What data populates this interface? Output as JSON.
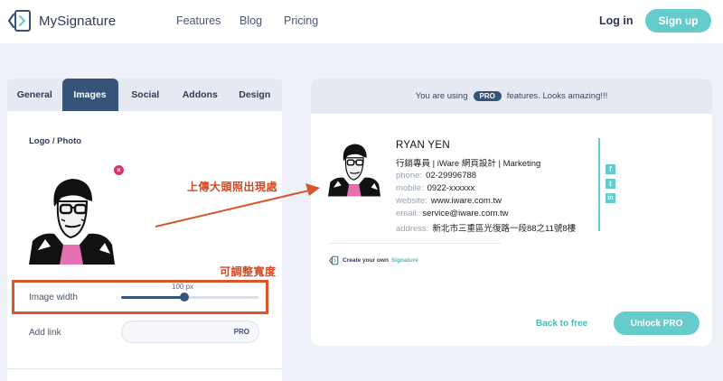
{
  "brand": {
    "name": "MySignature",
    "accent": "#66cbcb",
    "navy": "#36537a"
  },
  "nav": {
    "links": [
      "Features",
      "Blog",
      "Pricing"
    ],
    "login": "Log in",
    "signup": "Sign up"
  },
  "editor": {
    "tabs": [
      "General",
      "Images",
      "Social",
      "Addons",
      "Design"
    ],
    "active_tab": "Images",
    "logo_label": "Logo / Photo",
    "image_width_label": "Image width",
    "image_width_value": "100 px",
    "image_width_fraction": 0.46,
    "add_link_label": "Add link",
    "add_link_badge": "PRO"
  },
  "preview": {
    "banner_left": "You are using",
    "banner_pill": "PRO",
    "banner_right": "features. Looks amazing!!!",
    "signature": {
      "name": "RYAN YEN",
      "title": "行銷專員 | iWare 網頁設計 | Marketing",
      "lines": [
        {
          "key": "phone:",
          "value": "02-29996788"
        },
        {
          "key": "mobile:",
          "value": "0922-xxxxxx"
        },
        {
          "key": "website:",
          "value": "www.iware.com.tw"
        },
        {
          "key": "email:",
          "value": "service@iware.com.tw"
        },
        {
          "key": "address:",
          "value": "新北市三重區光復路一段88之11號8樓"
        }
      ],
      "social_icons": [
        "f",
        "t",
        "in"
      ]
    },
    "create_own_left": "Create your own",
    "create_own_right": "Signature",
    "back_free": "Back to free",
    "unlock": "Unlock PRO"
  },
  "annotations": {
    "upload_note": "上傳大頭照出現處",
    "width_note": "可調整寬度",
    "color": "#d9451f"
  }
}
